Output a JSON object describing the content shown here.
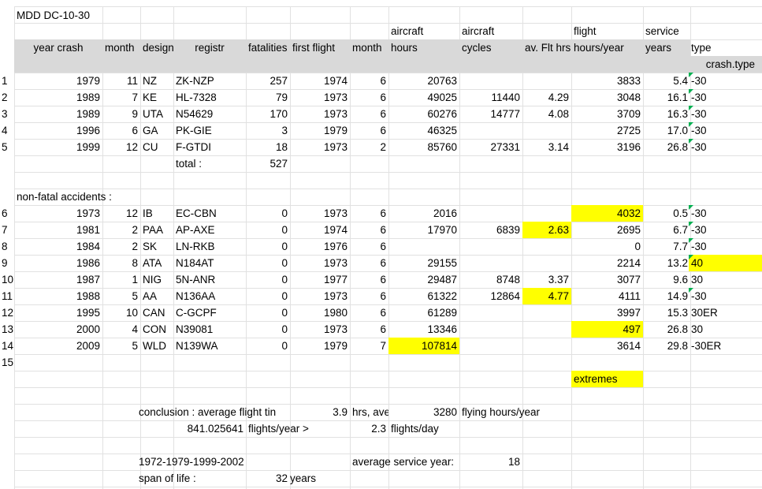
{
  "title": "MDD DC-10-30",
  "header_top": {
    "aircraft_hours": "aircraft",
    "aircraft_cycles": "aircraft",
    "flight": "flight",
    "service": "service"
  },
  "header": {
    "year_crash": "year crash",
    "month": "month",
    "designat": "designat",
    "registr": "registr",
    "fatalities": "fatalities",
    "first_flight": "first flight",
    "ff_month": "month",
    "hours": "hours",
    "cycles": "cycles",
    "av_flt_hrs": "av. Flt hrs",
    "hours_year": "hours/year",
    "years": "years",
    "type": "type"
  },
  "subheader_type": "crash.type",
  "row_numbers": [
    "1",
    "2",
    "3",
    "4",
    "5",
    "6",
    "7",
    "8",
    "9",
    "10",
    "11",
    "12",
    "13",
    "14",
    "15"
  ],
  "fatal_rows": [
    {
      "year": "1979",
      "month": "11",
      "des": "NZ",
      "reg": "ZK-NZP",
      "fat": "257",
      "ff": "1974",
      "ffm": "6",
      "hrs": "20763",
      "cyc": "",
      "avf": "",
      "hy": "3833",
      "yrs": "5.4",
      "type": "-30"
    },
    {
      "year": "1989",
      "month": "7",
      "des": "KE",
      "reg": "HL-7328",
      "fat": "79",
      "ff": "1973",
      "ffm": "6",
      "hrs": "49025",
      "cyc": "11440",
      "avf": "4.29",
      "hy": "3048",
      "yrs": "16.1",
      "type": "-30"
    },
    {
      "year": "1989",
      "month": "9",
      "des": "UTA",
      "reg": "N54629",
      "fat": "170",
      "ff": "1973",
      "ffm": "6",
      "hrs": "60276",
      "cyc": "14777",
      "avf": "4.08",
      "hy": "3709",
      "yrs": "16.3",
      "type": "-30"
    },
    {
      "year": "1996",
      "month": "6",
      "des": "GA",
      "reg": "PK-GIE",
      "fat": "3",
      "ff": "1979",
      "ffm": "6",
      "hrs": "46325",
      "cyc": "",
      "avf": "",
      "hy": "2725",
      "yrs": "17.0",
      "type": "-30"
    },
    {
      "year": "1999",
      "month": "12",
      "des": "CU",
      "reg": "F-GTDI",
      "fat": "18",
      "ff": "1973",
      "ffm": "2",
      "hrs": "85760",
      "cyc": "27331",
      "avf": "3.14",
      "hy": "3196",
      "yrs": "26.8",
      "type": "-30"
    }
  ],
  "total_label": "total :",
  "total_value": "527",
  "nonfatal_label": "non-fatal accidents :",
  "nonfatal_rows": [
    {
      "year": "1973",
      "month": "12",
      "des": "IB",
      "reg": "EC-CBN",
      "fat": "0",
      "ff": "1973",
      "ffm": "6",
      "hrs": "2016",
      "cyc": "",
      "avf": "",
      "hy": "4032",
      "yrs": "0.5",
      "type": "-30"
    },
    {
      "year": "1981",
      "month": "2",
      "des": "PAA",
      "reg": "AP-AXE",
      "fat": "0",
      "ff": "1974",
      "ffm": "6",
      "hrs": "17970",
      "cyc": "6839",
      "avf": "2.63",
      "hy": "2695",
      "yrs": "6.7",
      "type": "-30"
    },
    {
      "year": "1984",
      "month": "2",
      "des": "SK",
      "reg": "LN-RKB",
      "fat": "0",
      "ff": "1976",
      "ffm": "6",
      "hrs": "",
      "cyc": "",
      "avf": "",
      "hy": "0",
      "yrs": "7.7",
      "type": "-30"
    },
    {
      "year": "1986",
      "month": "8",
      "des": "ATA",
      "reg": "N184AT",
      "fat": "0",
      "ff": "1973",
      "ffm": "6",
      "hrs": "29155",
      "cyc": "",
      "avf": "",
      "hy": "2214",
      "yrs": "13.2",
      "type": "40"
    },
    {
      "year": "1987",
      "month": "1",
      "des": "NIG",
      "reg": "5N-ANR",
      "fat": "0",
      "ff": "1977",
      "ffm": "6",
      "hrs": "29487",
      "cyc": "8748",
      "avf": "3.37",
      "hy": "3077",
      "yrs": "9.6",
      "type": "30"
    },
    {
      "year": "1988",
      "month": "5",
      "des": "AA",
      "reg": "N136AA",
      "fat": "0",
      "ff": "1973",
      "ffm": "6",
      "hrs": "61322",
      "cyc": "12864",
      "avf": "4.77",
      "hy": "4111",
      "yrs": "14.9",
      "type": "-30"
    },
    {
      "year": "1995",
      "month": "10",
      "des": "CAN",
      "reg": "C-GCPF",
      "fat": "0",
      "ff": "1980",
      "ffm": "6",
      "hrs": "61289",
      "cyc": "",
      "avf": "",
      "hy": "3997",
      "yrs": "15.3",
      "type": "30ER"
    },
    {
      "year": "2000",
      "month": "4",
      "des": "CON",
      "reg": "N39081",
      "fat": "0",
      "ff": "1973",
      "ffm": "6",
      "hrs": "13346",
      "cyc": "",
      "avf": "",
      "hy": "497",
      "yrs": "26.8",
      "type": "30"
    },
    {
      "year": "2009",
      "month": "5",
      "des": "WLD",
      "reg": "N139WA",
      "fat": "0",
      "ff": "1979",
      "ffm": "7",
      "hrs": "107814",
      "cyc": "",
      "avf": "",
      "hy": "3614",
      "yrs": "29.8",
      "type": "-30ER"
    }
  ],
  "extremes_label": "extremes",
  "conclusion": {
    "label": "conclusion : average flight tin",
    "avg_hrs": "3.9",
    "hrs_ave": "hrs, ave",
    "hours_year_val": "3280",
    "flying_label": "flying hours/year",
    "flights_year_val": "841.025641",
    "flights_year_label": "flights/year >",
    "flights_day_val": "2.3",
    "flights_day_label": "flights/day"
  },
  "span": {
    "years_seq": "1972-1979-1999-2002",
    "avg_service_label": "average service year:",
    "avg_service_val": "18",
    "span_label": "span of life :",
    "span_val": "32",
    "span_unit": "years"
  },
  "colors": {
    "highlight": "#ffff00",
    "header_gray": "#d9d9d9",
    "gridline": "#e1e1e1",
    "comment_marker": "#00b050"
  }
}
